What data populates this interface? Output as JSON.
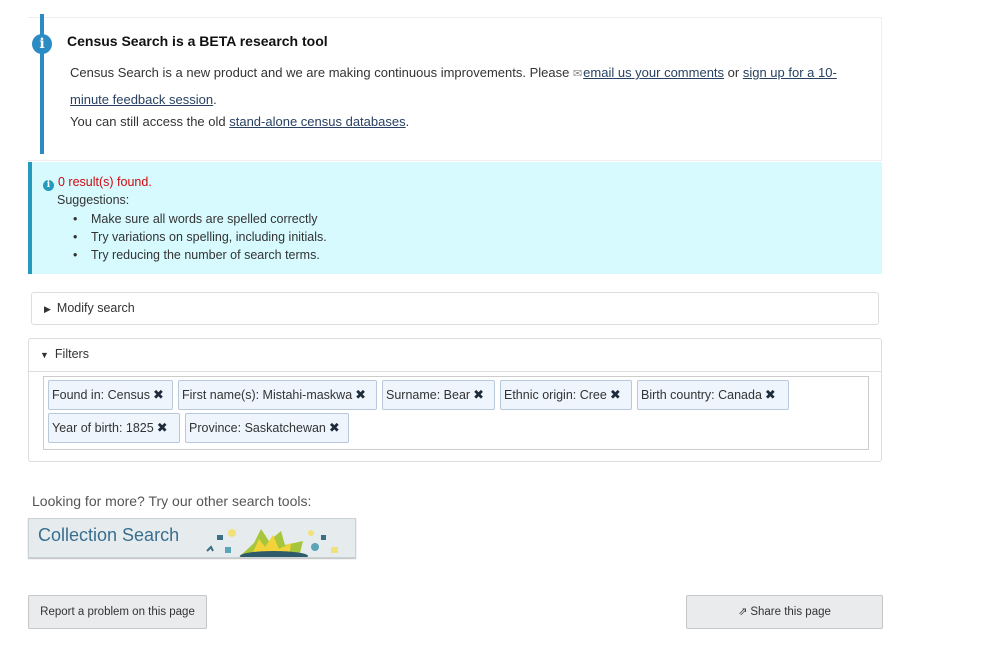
{
  "beta": {
    "title": "Census Search is a BETA research tool",
    "p1_text": "Census Search is a new product and we are making continuous improvements. Please ",
    "email_link": "email us your comments",
    "or_text": " or ",
    "signup_link": "sign up for a 10-minute feedback session",
    "p1_end": ".",
    "p2_text": "You can still access the old ",
    "p2_link": "stand-alone census databases",
    "p2_end": "."
  },
  "alert": {
    "results": "0 result(s) found.",
    "suggestions_label": "Suggestions:",
    "suggestions": [
      "Make sure all words are spelled correctly",
      "Try variations on spelling, including initials.",
      "Try reducing the number of search terms."
    ]
  },
  "modify_search": {
    "label": "Modify search"
  },
  "filters": {
    "label": "Filters",
    "chips": [
      {
        "label": "Found in:  Census"
      },
      {
        "label": "First name(s):  Mistahi-maskwa"
      },
      {
        "label": "Surname:  Bear"
      },
      {
        "label": "Ethnic origin:  Cree"
      },
      {
        "label": "Birth country:  Canada"
      },
      {
        "label": "Year of birth:  1825"
      },
      {
        "label": "Province:  Saskatchewan"
      }
    ],
    "remove_glyph": "✖"
  },
  "more_tools": {
    "label": "Looking for more? Try our other search tools:",
    "collection_search": "Collection Search"
  },
  "footer": {
    "report_label": "Report a problem on this page",
    "share_label": "Share this page"
  },
  "colors": {
    "accent": "#2b8cc4",
    "alert_bg": "#d7faff",
    "alert_text": "#d3080c",
    "chip_bg": "#eef5fd",
    "link": "#284162"
  }
}
